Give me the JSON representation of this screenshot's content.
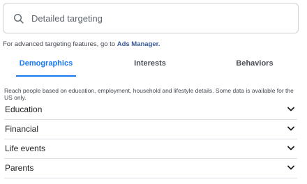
{
  "search": {
    "placeholder": "Detailed targeting"
  },
  "hint": {
    "text": "For advanced targeting features, go to",
    "link": "Ads Manager."
  },
  "tabs": [
    {
      "label": "Demographics",
      "active": true
    },
    {
      "label": "Interests",
      "active": false
    },
    {
      "label": "Behaviors",
      "active": false
    }
  ],
  "description": "Reach people based on education, employment, household and lifestyle details. Some data is available for the US only.",
  "categories": [
    {
      "label": "Education"
    },
    {
      "label": "Financial"
    },
    {
      "label": "Life events"
    },
    {
      "label": "Parents"
    }
  ],
  "colors": {
    "accent": "#1877f2",
    "link": "#385898",
    "border": "#ced0d4"
  }
}
